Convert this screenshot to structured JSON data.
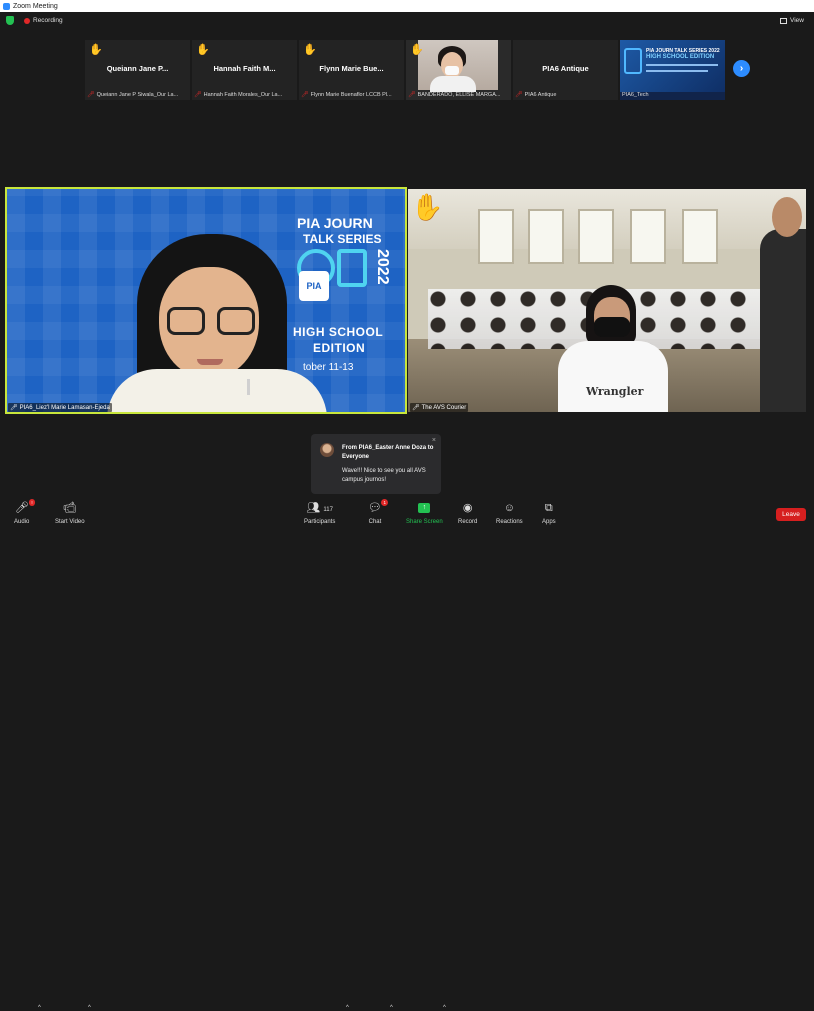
{
  "window": {
    "title": "Zoom Meeting"
  },
  "topbar": {
    "recording_label": "Recording",
    "view_label": "View"
  },
  "strip": {
    "tiles": [
      {
        "big": "Queiann Jane P...",
        "small": "Queiann Jane P Siwala_Our La..."
      },
      {
        "big": "Hannah Faith M...",
        "small": "Hannah Faith Morales_Our La..."
      },
      {
        "big": "Flynn Marie Bue...",
        "small": "Flynn Marie Buenaflor LCCB Pl..."
      },
      {
        "big": "",
        "small": "BANDERADO, ELLISE MARGA..."
      },
      {
        "big": "PIA6 Antique",
        "small": "PIA6 Antique"
      },
      {
        "big": "",
        "small": "PIA6_Tech"
      }
    ],
    "poster": {
      "title": "PIA JOURN TALK SERIES 2022",
      "edition": "HIGH SCHOOL EDITION"
    }
  },
  "main_left": {
    "name_label": "PIA6_Liez'l Marie Lamasan-Ejeda",
    "series_line1": "PIA JOURN",
    "series_line2": "TALK SERIES",
    "year": "2022",
    "logo_text": "PIA",
    "edition_line1": "HIGH SCHOOL",
    "edition_line2": "EDITION",
    "dates": "tober 11-13"
  },
  "main_right": {
    "name_label": "The AVS Courier",
    "shirt_text": "Wrangler"
  },
  "chat_toast": {
    "from": "From PIA6_Easter Anne Doza to Everyone",
    "message": "Wave!!! Nice to see you all AVS campus journos!",
    "close": "×"
  },
  "toolbar": {
    "audio": "Audio",
    "start_video": "Start Video",
    "participants": "Participants",
    "participants_count": "117",
    "chat": "Chat",
    "chat_badge": "1",
    "share_screen": "Share Screen",
    "record": "Record",
    "reactions": "Reactions",
    "apps": "Apps",
    "leave": "Leave"
  },
  "colors": {
    "accent": "#2d8cff",
    "share": "#23c152",
    "leave": "#d61f1f",
    "active_speaker": "#c8e63c"
  }
}
